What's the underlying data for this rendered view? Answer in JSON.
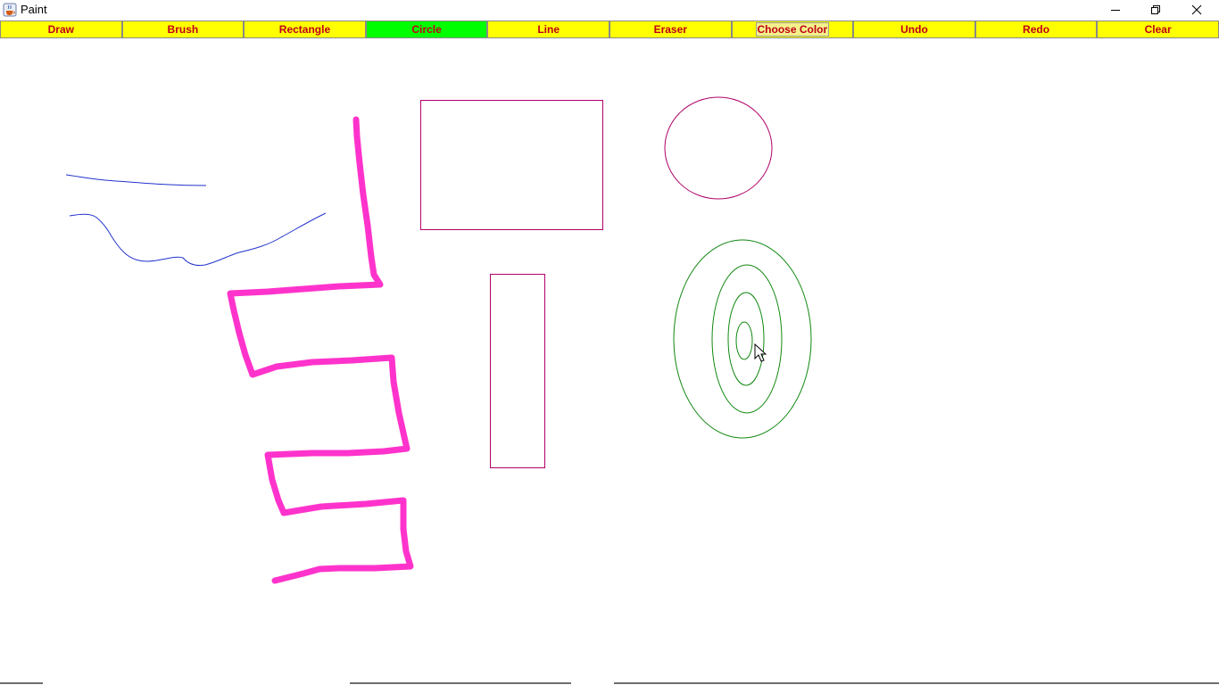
{
  "window": {
    "title": "Paint",
    "icon": "java-cup-icon"
  },
  "window_controls": {
    "minimize_icon": "minimize-icon",
    "maximize_icon": "restore-icon",
    "close_icon": "close-icon"
  },
  "toolbar": {
    "buttons": [
      {
        "label": "Draw"
      },
      {
        "label": "Brush"
      },
      {
        "label": "Rectangle"
      },
      {
        "label": "Circle",
        "selected": true
      },
      {
        "label": "Line"
      },
      {
        "label": "Eraser"
      },
      {
        "label": "Choose Color"
      },
      {
        "label": "Undo"
      },
      {
        "label": "Redo"
      },
      {
        "label": "Clear"
      }
    ],
    "button_bg": "#ffff00",
    "selected_bg": "#00ff00",
    "label_color": "#c0001a"
  },
  "canvas": {
    "background": "#ffffff",
    "stroke_colors": {
      "blue_pencil": "#2233cc",
      "magenta_brush": "#ff33cc",
      "rectangle": "#b0006a",
      "circle_single": "#b0006a",
      "circles_concentric": "#118811"
    },
    "cursor_icon": "mouse-pointer-icon"
  }
}
